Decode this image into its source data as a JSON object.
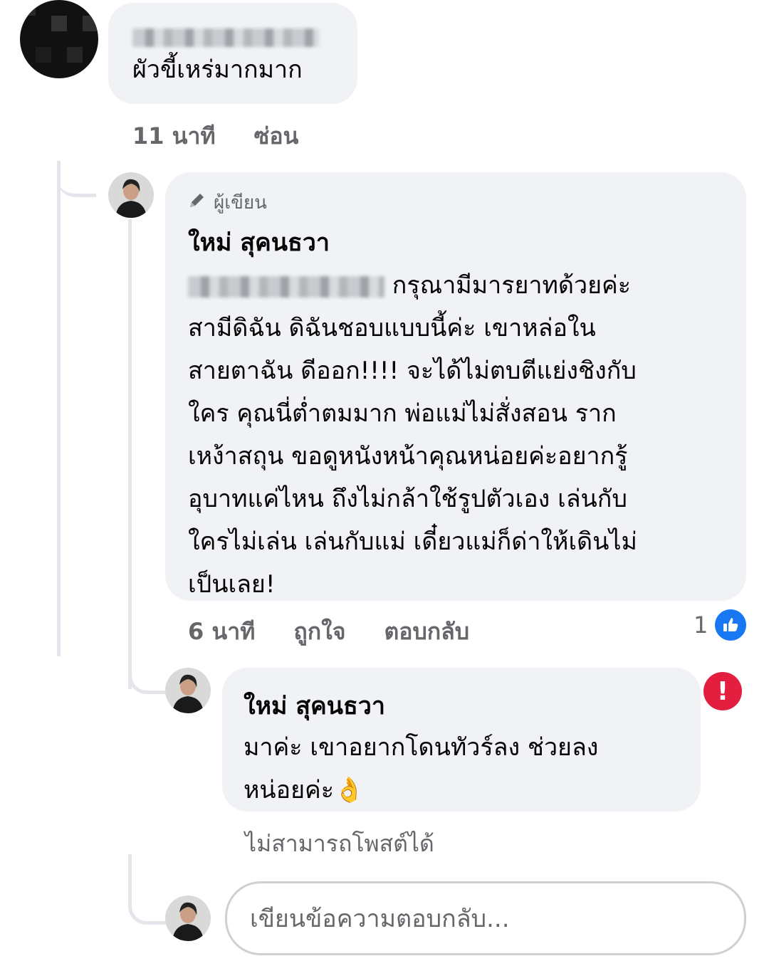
{
  "comment": {
    "author_name_blurred": "",
    "text": "ผัวขี้เหร่มากมาก",
    "time": "11 นาที",
    "hide_label": "ซ่อน"
  },
  "reply1": {
    "author_badge": "ผู้เขียน",
    "author_name": "ใหม่ สุคนธวา",
    "text_lines": [
      " กรุณามีมารยาทด้วยค่ะ",
      "สามีดิฉัน ดิฉันชอบแบบนี้ค่ะ เขาหล่อใน",
      "สายตาฉัน ดีออก!!!! จะได้ไม่ตบตีแย่งชิงกับ",
      "ใคร คุณนี่ต่ำตมมาก พ่อแม่ไม่สั่งสอน ราก",
      "เหง้าสถุน ขอดูหนังหน้าคุณหน่อยค่ะอยากรู้",
      "อุบาทแค่ไหน ถึงไม่กล้าใช้รูปตัวเอง เล่นกับ",
      "ใครไม่เล่น เล่นกับแม่ เดี๋ยวแม่ก็ด่าให้เดินไม่",
      "เป็นเลย!"
    ],
    "time": "6 นาที",
    "like_label": "ถูกใจ",
    "reply_label": "ตอบกลับ",
    "reaction_count": "1",
    "reaction_icon": "thumbs-up-icon"
  },
  "reply2": {
    "author_name": "ใหม่ สุคนธวา",
    "text_lines": [
      "มาค่ะ เขาอยากโดนทัวร์ลง ช่วยลง",
      "หน่อยค่ะ👌"
    ],
    "status": "ไม่สามารถโพสต์ได้",
    "error_icon": "!"
  },
  "composer": {
    "placeholder": "เขียนข้อความตอบกลับ..."
  },
  "colors": {
    "bubble_bg": "#f0f2f5",
    "meta_text": "#65676b",
    "like_blue": "#1877f2",
    "error_red": "#e41e3f",
    "thread_line": "#e4e6eb"
  }
}
